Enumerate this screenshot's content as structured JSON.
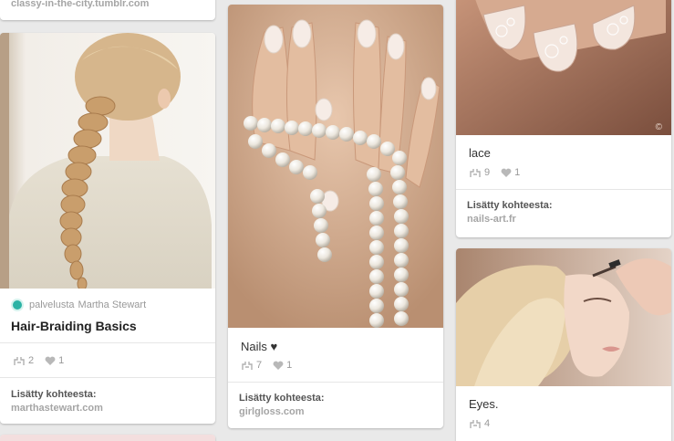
{
  "pins": [
    {
      "id": "top-card",
      "source_domain": "classy-in-the-city.tumblr.com"
    },
    {
      "id": "hair-braiding",
      "via_prefix": "palvelusta",
      "via_name": "Martha Stewart",
      "title": "Hair-Braiding Basics",
      "repins": "2",
      "likes": "1",
      "source_label": "Lisätty kohteesta:",
      "source_domain": "marthastewart.com"
    },
    {
      "id": "nails-pearls",
      "description": "Nails ♥",
      "repins": "7",
      "likes": "1",
      "source_label": "Lisätty kohteesta:",
      "source_domain": "girlgloss.com"
    },
    {
      "id": "lace-nails",
      "description": "lace",
      "repins": "9",
      "likes": "1",
      "source_label": "Lisätty kohteesta:",
      "source_domain": "nails-art.fr",
      "image_corner_text": "©"
    },
    {
      "id": "eyes",
      "description": "Eyes.",
      "repins": "4"
    }
  ],
  "icons": {
    "repin": "repin-icon",
    "like": "heart-icon"
  },
  "colors": {
    "background": "#e9e9e9",
    "card": "#ffffff",
    "via_badge": "#2bb3a5"
  }
}
